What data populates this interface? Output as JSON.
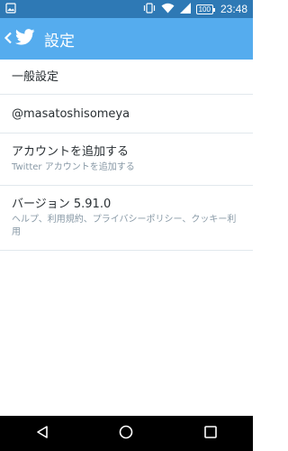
{
  "status_bar": {
    "battery": "100",
    "time": "23:48",
    "icons": [
      "image-notification-icon",
      "vibrate-icon",
      "wifi-icon",
      "signal-icon",
      "battery-icon"
    ]
  },
  "app_bar": {
    "title": "設定",
    "icons": [
      "back-arrow-icon",
      "twitter-bird-icon"
    ],
    "color": "#55acee"
  },
  "settings": {
    "items": [
      {
        "title": "一般設定"
      },
      {
        "title": "@masatoshisomeya"
      },
      {
        "title": "アカウントを追加する",
        "subtitle": "Twitter アカウントを追加する"
      },
      {
        "title": "バージョン 5.91.0",
        "subtitle": "ヘルプ、利用規約、プライバシーポリシー、クッキー利用"
      }
    ]
  },
  "nav_bar": {
    "icons": [
      "back-icon",
      "home-icon",
      "recents-icon"
    ]
  }
}
